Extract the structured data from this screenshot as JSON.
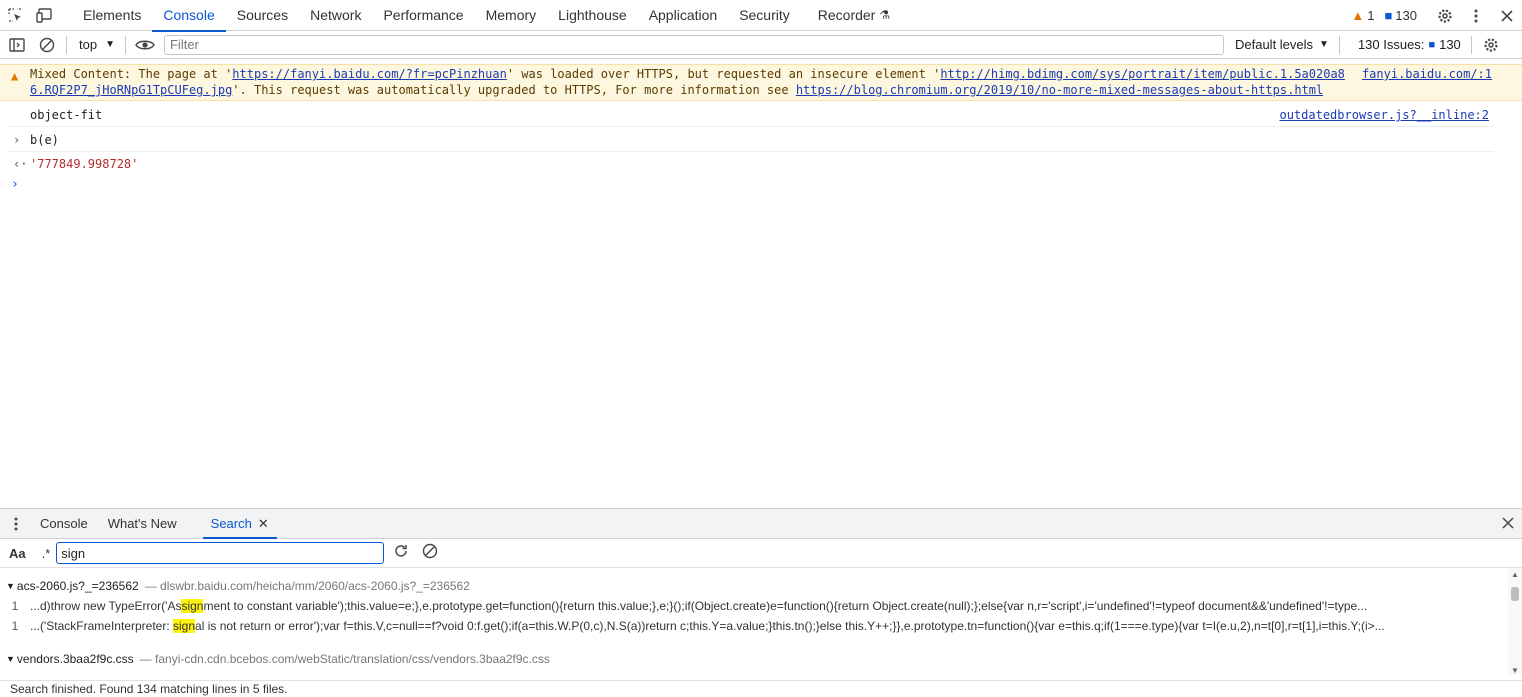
{
  "topbar": {
    "tabs": [
      "Elements",
      "Console",
      "Sources",
      "Network",
      "Performance",
      "Memory",
      "Lighthouse",
      "Application",
      "Security",
      "Recorder"
    ],
    "warn_count": "1",
    "msg_count": "130"
  },
  "toolbar": {
    "context": "top",
    "filter_placeholder": "Filter",
    "levels": "Default levels",
    "issues_label": "130 Issues:",
    "issues_count": "130"
  },
  "console": {
    "warning": {
      "prefix": "Mixed Content: The page at '",
      "url1": "https://fanyi.baidu.com/?fr=pcPinzhuan",
      "mid": "' was loaded over HTTPS, but requested an insecure element '",
      "url2": "http://himg.bdimg.com/sys/portrait/item/public.1.5a020a8",
      "src": "fanyi.baidu.com/:1",
      "url2b": "6.RQF2P7_jHoRNpG1TpCUFeg.jpg",
      "mid2": "'. This request was automatically upgraded to HTTPS, For more information see ",
      "url3": "https://blog.chromium.org/2019/10/no-more-mixed-messages-about-https.html"
    },
    "log1": "object-fit",
    "log1_src": "outdatedbrowser.js?__inline:2",
    "input1": "b(e)",
    "output1": "'777849.998728'"
  },
  "drawer": {
    "tabs": [
      "Console",
      "What's New",
      "Search"
    ],
    "search_value": "sign",
    "case_label": "Aa",
    "regex_label": ".*"
  },
  "results": {
    "file1": {
      "name": "acs-2060.js?_=236562",
      "path": "dlswbr.baidu.com/heicha/mm/2060/acs-2060.js?_=236562"
    },
    "f1l1": {
      "num": "1",
      "pre": "...d)throw new TypeError('As",
      "hit": "sign",
      "post": "ment to constant variable');this.value=e;},e.prototype.get=function(){return this.value;},e;}();if(Object.create)e=function(){return Object.create(null);};else{var n,r='script',i='undefined'!=typeof document&&'undefined'!=type..."
    },
    "f1l2": {
      "num": "1",
      "pre": "...('StackFrameInterpreter: ",
      "hit": "sign",
      "post": "al is not return or error');var f=this.V,c=null==f?void 0:f.get();if(a=this.W.P(0,c),N.S(a))return c;this.Y=a.value;}this.tn();}else this.Y++;}},e.prototype.tn=function(){var e=this.q;if(1===e.type){var t=I(e.u,2),n=t[0],r=t[1],i=this.Y;(i>..."
    },
    "file2": {
      "name": "vendors.3baa2f9c.css",
      "path": "fanyi-cdn.cdn.bcebos.com/webStatic/translation/css/vendors.3baa2f9c.css"
    }
  },
  "status": "Search finished.  Found 134 matching lines in 5 files."
}
